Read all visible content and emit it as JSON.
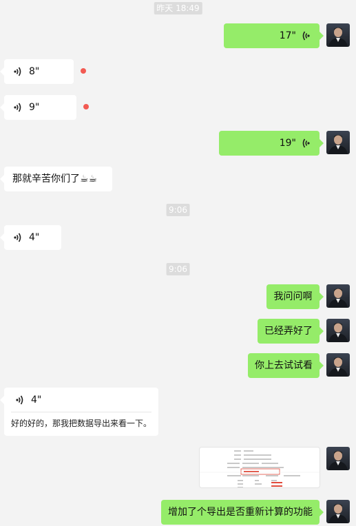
{
  "messages": {
    "ts1": "昨天 18:49",
    "voice1": "17\"",
    "voice2": "8\"",
    "voice3": "9\"",
    "voice4": "19\"",
    "text1": "那就辛苦你们了☕☕",
    "ts2": "9:06",
    "voice5": "4\"",
    "ts3": "9:06",
    "text2": "我问问啊",
    "text3": "已经弄好了",
    "text4": "你上去试试看",
    "card_voice": "4\"",
    "card_transcript": "好的好的，那我把数据导出来看一下。",
    "text5": "增加了个导出是否重新计算的功能"
  },
  "colors": {
    "outgoing_bubble": "#95ec69",
    "incoming_bubble": "#ffffff",
    "background": "#f3f3f3",
    "unread_dot": "#f25a52"
  },
  "icons": {
    "voice": "voice-wave-icon",
    "avatar": "user-avatar-photo"
  }
}
